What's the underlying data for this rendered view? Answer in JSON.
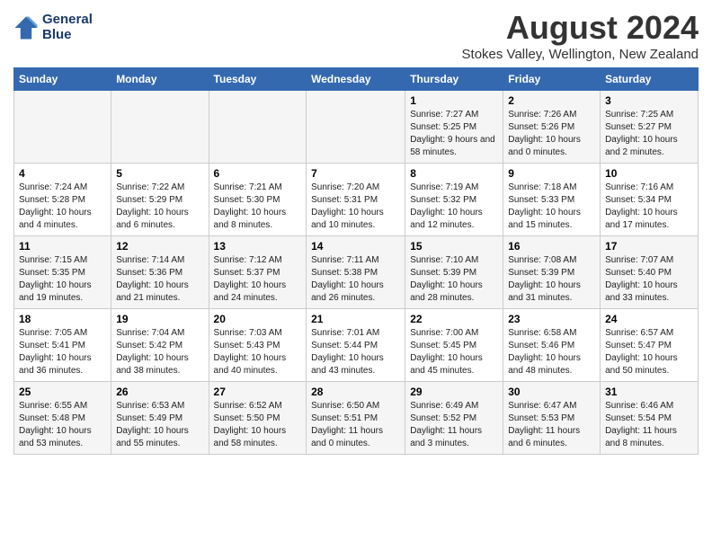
{
  "logo": {
    "line1": "General",
    "line2": "Blue"
  },
  "title": "August 2024",
  "subtitle": "Stokes Valley, Wellington, New Zealand",
  "days_of_week": [
    "Sunday",
    "Monday",
    "Tuesday",
    "Wednesday",
    "Thursday",
    "Friday",
    "Saturday"
  ],
  "weeks": [
    [
      {
        "day": "",
        "info": ""
      },
      {
        "day": "",
        "info": ""
      },
      {
        "day": "",
        "info": ""
      },
      {
        "day": "",
        "info": ""
      },
      {
        "day": "1",
        "info": "Sunrise: 7:27 AM\nSunset: 5:25 PM\nDaylight: 9 hours and 58 minutes."
      },
      {
        "day": "2",
        "info": "Sunrise: 7:26 AM\nSunset: 5:26 PM\nDaylight: 10 hours and 0 minutes."
      },
      {
        "day": "3",
        "info": "Sunrise: 7:25 AM\nSunset: 5:27 PM\nDaylight: 10 hours and 2 minutes."
      }
    ],
    [
      {
        "day": "4",
        "info": "Sunrise: 7:24 AM\nSunset: 5:28 PM\nDaylight: 10 hours and 4 minutes."
      },
      {
        "day": "5",
        "info": "Sunrise: 7:22 AM\nSunset: 5:29 PM\nDaylight: 10 hours and 6 minutes."
      },
      {
        "day": "6",
        "info": "Sunrise: 7:21 AM\nSunset: 5:30 PM\nDaylight: 10 hours and 8 minutes."
      },
      {
        "day": "7",
        "info": "Sunrise: 7:20 AM\nSunset: 5:31 PM\nDaylight: 10 hours and 10 minutes."
      },
      {
        "day": "8",
        "info": "Sunrise: 7:19 AM\nSunset: 5:32 PM\nDaylight: 10 hours and 12 minutes."
      },
      {
        "day": "9",
        "info": "Sunrise: 7:18 AM\nSunset: 5:33 PM\nDaylight: 10 hours and 15 minutes."
      },
      {
        "day": "10",
        "info": "Sunrise: 7:16 AM\nSunset: 5:34 PM\nDaylight: 10 hours and 17 minutes."
      }
    ],
    [
      {
        "day": "11",
        "info": "Sunrise: 7:15 AM\nSunset: 5:35 PM\nDaylight: 10 hours and 19 minutes."
      },
      {
        "day": "12",
        "info": "Sunrise: 7:14 AM\nSunset: 5:36 PM\nDaylight: 10 hours and 21 minutes."
      },
      {
        "day": "13",
        "info": "Sunrise: 7:12 AM\nSunset: 5:37 PM\nDaylight: 10 hours and 24 minutes."
      },
      {
        "day": "14",
        "info": "Sunrise: 7:11 AM\nSunset: 5:38 PM\nDaylight: 10 hours and 26 minutes."
      },
      {
        "day": "15",
        "info": "Sunrise: 7:10 AM\nSunset: 5:39 PM\nDaylight: 10 hours and 28 minutes."
      },
      {
        "day": "16",
        "info": "Sunrise: 7:08 AM\nSunset: 5:39 PM\nDaylight: 10 hours and 31 minutes."
      },
      {
        "day": "17",
        "info": "Sunrise: 7:07 AM\nSunset: 5:40 PM\nDaylight: 10 hours and 33 minutes."
      }
    ],
    [
      {
        "day": "18",
        "info": "Sunrise: 7:05 AM\nSunset: 5:41 PM\nDaylight: 10 hours and 36 minutes."
      },
      {
        "day": "19",
        "info": "Sunrise: 7:04 AM\nSunset: 5:42 PM\nDaylight: 10 hours and 38 minutes."
      },
      {
        "day": "20",
        "info": "Sunrise: 7:03 AM\nSunset: 5:43 PM\nDaylight: 10 hours and 40 minutes."
      },
      {
        "day": "21",
        "info": "Sunrise: 7:01 AM\nSunset: 5:44 PM\nDaylight: 10 hours and 43 minutes."
      },
      {
        "day": "22",
        "info": "Sunrise: 7:00 AM\nSunset: 5:45 PM\nDaylight: 10 hours and 45 minutes."
      },
      {
        "day": "23",
        "info": "Sunrise: 6:58 AM\nSunset: 5:46 PM\nDaylight: 10 hours and 48 minutes."
      },
      {
        "day": "24",
        "info": "Sunrise: 6:57 AM\nSunset: 5:47 PM\nDaylight: 10 hours and 50 minutes."
      }
    ],
    [
      {
        "day": "25",
        "info": "Sunrise: 6:55 AM\nSunset: 5:48 PM\nDaylight: 10 hours and 53 minutes."
      },
      {
        "day": "26",
        "info": "Sunrise: 6:53 AM\nSunset: 5:49 PM\nDaylight: 10 hours and 55 minutes."
      },
      {
        "day": "27",
        "info": "Sunrise: 6:52 AM\nSunset: 5:50 PM\nDaylight: 10 hours and 58 minutes."
      },
      {
        "day": "28",
        "info": "Sunrise: 6:50 AM\nSunset: 5:51 PM\nDaylight: 11 hours and 0 minutes."
      },
      {
        "day": "29",
        "info": "Sunrise: 6:49 AM\nSunset: 5:52 PM\nDaylight: 11 hours and 3 minutes."
      },
      {
        "day": "30",
        "info": "Sunrise: 6:47 AM\nSunset: 5:53 PM\nDaylight: 11 hours and 6 minutes."
      },
      {
        "day": "31",
        "info": "Sunrise: 6:46 AM\nSunset: 5:54 PM\nDaylight: 11 hours and 8 minutes."
      }
    ]
  ]
}
